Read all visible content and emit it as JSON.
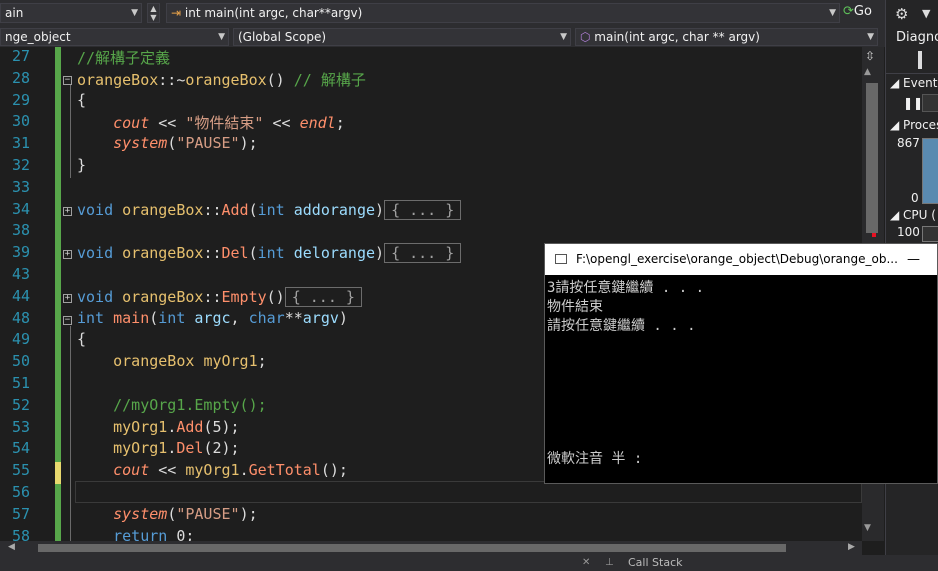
{
  "toolbar": {
    "project_combo": "ain",
    "function_combo": "int main(int argc, char**argv)",
    "go_button": "Go"
  },
  "navbar": {
    "project": "nge_object",
    "scope": "(Global Scope)",
    "member": "main(int argc, char ** argv)"
  },
  "editor": {
    "lines": [
      {
        "n": "27",
        "segments": [
          {
            "t": "//解構子定義",
            "c": "cmt"
          }
        ]
      },
      {
        "n": "28",
        "segments": [
          {
            "t": "orangeBox",
            "c": "cls"
          },
          {
            "t": "::~",
            "c": ""
          },
          {
            "t": "orangeBox",
            "c": "cls"
          },
          {
            "t": "() ",
            "c": ""
          },
          {
            "t": "// 解構子",
            "c": "cmt"
          }
        ]
      },
      {
        "n": "29",
        "segments": [
          {
            "t": "{",
            "c": ""
          }
        ]
      },
      {
        "n": "30",
        "segments": [
          {
            "t": "    ",
            "c": ""
          },
          {
            "t": "cout",
            "c": "it"
          },
          {
            "t": " << ",
            "c": ""
          },
          {
            "t": "\"物件結束\"",
            "c": "str"
          },
          {
            "t": " << ",
            "c": ""
          },
          {
            "t": "endl",
            "c": "it"
          },
          {
            "t": ";",
            "c": ""
          }
        ]
      },
      {
        "n": "31",
        "segments": [
          {
            "t": "    ",
            "c": ""
          },
          {
            "t": "system",
            "c": "it"
          },
          {
            "t": "(",
            "c": ""
          },
          {
            "t": "\"PAUSE\"",
            "c": "str"
          },
          {
            "t": ");",
            "c": ""
          }
        ]
      },
      {
        "n": "32",
        "segments": [
          {
            "t": "}",
            "c": ""
          }
        ]
      },
      {
        "n": "33",
        "segments": []
      },
      {
        "n": "34",
        "segments": [
          {
            "t": "void ",
            "c": "kw"
          },
          {
            "t": "orangeBox",
            "c": "cls"
          },
          {
            "t": "::",
            "c": ""
          },
          {
            "t": "Add",
            "c": "fn"
          },
          {
            "t": "(",
            "c": ""
          },
          {
            "t": "int ",
            "c": "kw"
          },
          {
            "t": "addorange",
            "c": "var"
          },
          {
            "t": ")",
            "c": ""
          },
          {
            "t": "{ ... }",
            "c": "box"
          }
        ]
      },
      {
        "n": "38",
        "segments": []
      },
      {
        "n": "39",
        "segments": [
          {
            "t": "void ",
            "c": "kw"
          },
          {
            "t": "orangeBox",
            "c": "cls"
          },
          {
            "t": "::",
            "c": ""
          },
          {
            "t": "Del",
            "c": "fn"
          },
          {
            "t": "(",
            "c": ""
          },
          {
            "t": "int ",
            "c": "kw"
          },
          {
            "t": "delorange",
            "c": "var"
          },
          {
            "t": ")",
            "c": ""
          },
          {
            "t": "{ ... }",
            "c": "box"
          }
        ]
      },
      {
        "n": "43",
        "segments": []
      },
      {
        "n": "44",
        "segments": [
          {
            "t": "void ",
            "c": "kw"
          },
          {
            "t": "orangeBox",
            "c": "cls"
          },
          {
            "t": "::",
            "c": ""
          },
          {
            "t": "Empty",
            "c": "fn"
          },
          {
            "t": "()",
            "c": ""
          },
          {
            "t": "{ ... }",
            "c": "box"
          }
        ]
      },
      {
        "n": "48",
        "segments": [
          {
            "t": "int ",
            "c": "kw"
          },
          {
            "t": "main",
            "c": "fn"
          },
          {
            "t": "(",
            "c": ""
          },
          {
            "t": "int ",
            "c": "kw"
          },
          {
            "t": "argc",
            "c": "var"
          },
          {
            "t": ", ",
            "c": ""
          },
          {
            "t": "char",
            "c": "kw"
          },
          {
            "t": "**",
            "c": ""
          },
          {
            "t": "argv",
            "c": "var"
          },
          {
            "t": ")",
            "c": ""
          }
        ]
      },
      {
        "n": "49",
        "segments": [
          {
            "t": "{",
            "c": ""
          }
        ]
      },
      {
        "n": "50",
        "segments": [
          {
            "t": "    ",
            "c": ""
          },
          {
            "t": "orangeBox",
            "c": "cls"
          },
          {
            "t": " ",
            "c": ""
          },
          {
            "t": "myOrg1",
            "c": "cls"
          },
          {
            "t": ";",
            "c": ""
          }
        ]
      },
      {
        "n": "51",
        "segments": []
      },
      {
        "n": "52",
        "segments": [
          {
            "t": "    ",
            "c": ""
          },
          {
            "t": "//myOrg1.Empty();",
            "c": "cmt"
          }
        ]
      },
      {
        "n": "53",
        "segments": [
          {
            "t": "    ",
            "c": ""
          },
          {
            "t": "myOrg1",
            "c": "cls"
          },
          {
            "t": ".",
            "c": ""
          },
          {
            "t": "Add",
            "c": "fn"
          },
          {
            "t": "(5);",
            "c": ""
          }
        ]
      },
      {
        "n": "54",
        "segments": [
          {
            "t": "    ",
            "c": ""
          },
          {
            "t": "myOrg1",
            "c": "cls"
          },
          {
            "t": ".",
            "c": ""
          },
          {
            "t": "Del",
            "c": "fn"
          },
          {
            "t": "(2);",
            "c": ""
          }
        ]
      },
      {
        "n": "55",
        "segments": [
          {
            "t": "    ",
            "c": ""
          },
          {
            "t": "cout",
            "c": "it"
          },
          {
            "t": " << ",
            "c": ""
          },
          {
            "t": "myOrg1",
            "c": "cls"
          },
          {
            "t": ".",
            "c": ""
          },
          {
            "t": "GetTotal",
            "c": "fn"
          },
          {
            "t": "();",
            "c": ""
          }
        ]
      },
      {
        "n": "56",
        "segments": []
      },
      {
        "n": "57",
        "segments": [
          {
            "t": "    ",
            "c": ""
          },
          {
            "t": "system",
            "c": "it"
          },
          {
            "t": "(",
            "c": ""
          },
          {
            "t": "\"PAUSE\"",
            "c": "str"
          },
          {
            "t": ");",
            "c": ""
          }
        ]
      },
      {
        "n": "58",
        "segments": [
          {
            "t": "    ",
            "c": ""
          },
          {
            "t": "return ",
            "c": "kw"
          },
          {
            "t": "0;",
            "c": ""
          }
        ]
      }
    ]
  },
  "diagnostics": {
    "title": "Diagno",
    "events": "Events",
    "process": "Proces",
    "val_867": "867",
    "val_0": "0",
    "cpu": "CPU (",
    "val_100": "100"
  },
  "console": {
    "title": "F:\\opengl_exercise\\orange_object\\Debug\\orange_ob...",
    "minimize": "—",
    "lines": [
      "3請按任意鍵繼續 . . .",
      "物件結束",
      "請按任意鍵繼續 . . ."
    ],
    "ime": "微軟注音 半 :"
  },
  "statusbar": {
    "callstack": "Call Stack"
  },
  "colors": {
    "background": "#1e1e1e",
    "keyword": "#569cd6",
    "class": "#e6c06e",
    "function": "#ff8f6b",
    "string": "#d69d85",
    "comment": "#57a64a"
  }
}
